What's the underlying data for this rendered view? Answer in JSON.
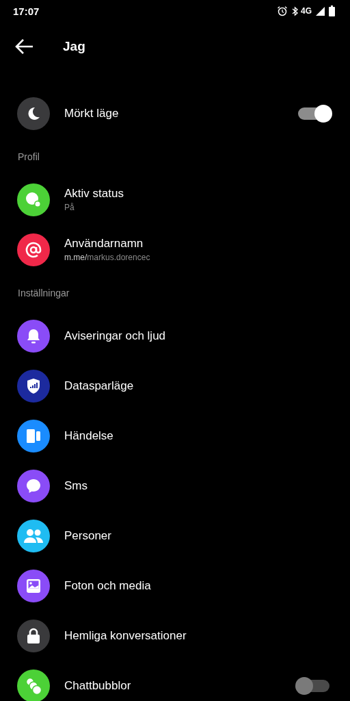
{
  "status_bar": {
    "time": "17:07",
    "network": "4G"
  },
  "header": {
    "title": "Jag"
  },
  "sections": [
    {
      "items": [
        {
          "kind": "toggle",
          "color": "#3a3a3c",
          "label": "Mörkt läge",
          "on": true
        }
      ]
    },
    {
      "header": "Profil",
      "items": [
        {
          "kind": "plain",
          "color": "#4cd137",
          "label": "Aktiv status",
          "subtitle": "På"
        },
        {
          "kind": "plain",
          "color": "#f02849",
          "label": "Användarnamn",
          "subtitle_prefix": "m.me/",
          "subtitle": "markus.dorencec"
        }
      ]
    },
    {
      "header": "Inställningar",
      "items": [
        {
          "kind": "plain",
          "color": "#8a4cf7",
          "label": "Aviseringar och ljud"
        },
        {
          "kind": "plain",
          "color": "#1c2a9e",
          "label": "Datasparläge"
        },
        {
          "kind": "plain",
          "color": "#1a8cff",
          "label": "Händelse"
        },
        {
          "kind": "plain",
          "color": "#8a4cf7",
          "label": "Sms"
        },
        {
          "kind": "plain",
          "color": "#1fbcf2",
          "label": "Personer"
        },
        {
          "kind": "plain",
          "color": "#8a4cf7",
          "label": "Foton och media"
        },
        {
          "kind": "plain",
          "color": "#3a3a3c",
          "label": "Hemliga konversationer"
        },
        {
          "kind": "toggle",
          "color": "#4cd137",
          "label": "Chattbubblor",
          "on": false
        }
      ]
    }
  ]
}
